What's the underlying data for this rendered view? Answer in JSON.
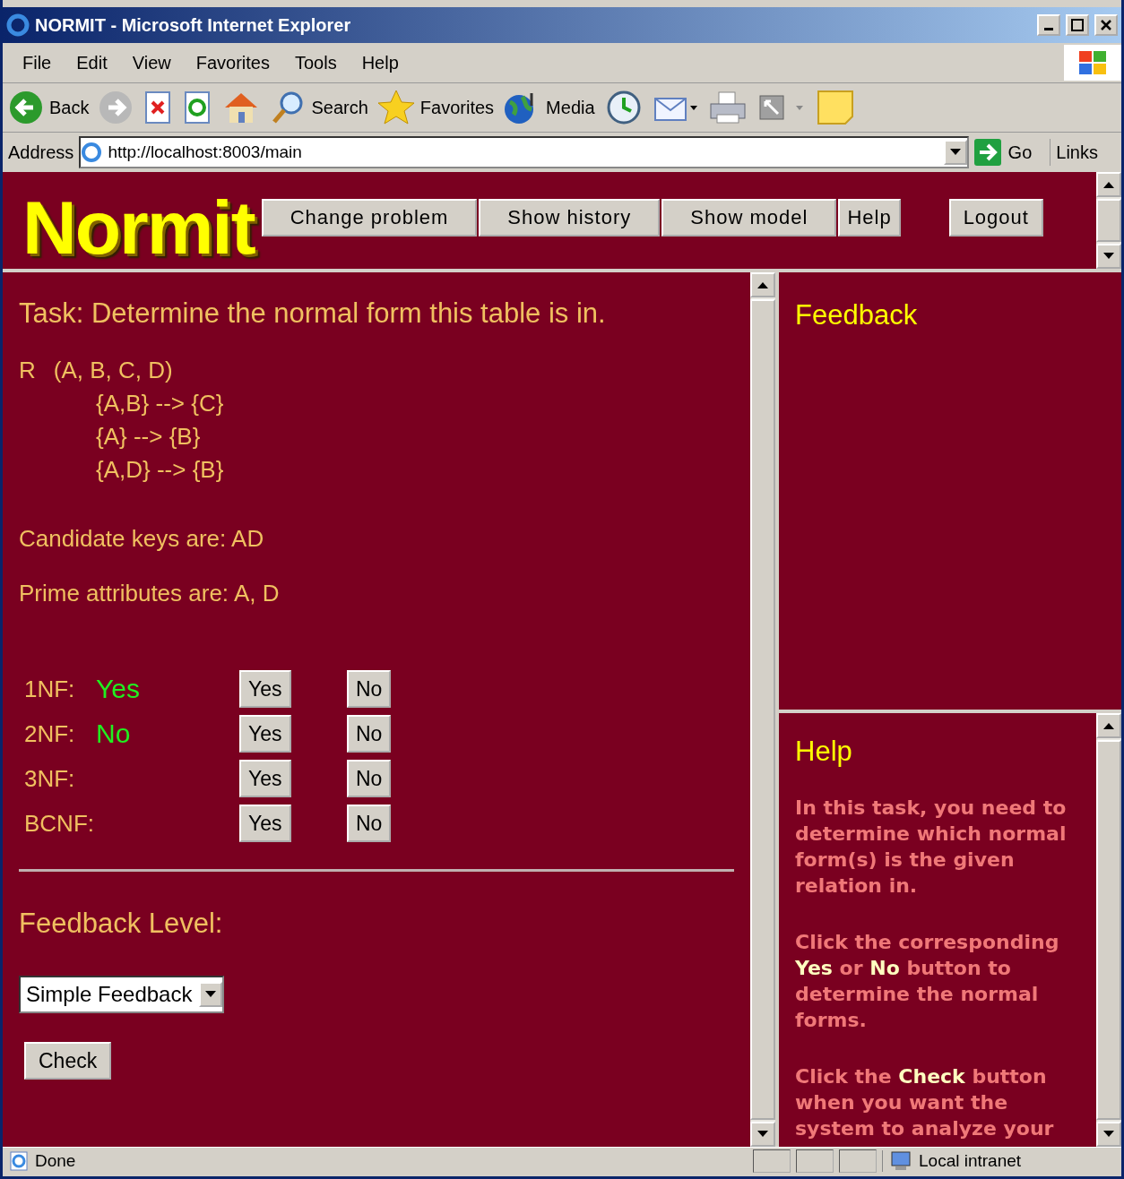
{
  "window": {
    "title": "NORMIT - Microsoft Internet Explorer"
  },
  "menu": [
    "File",
    "Edit",
    "View",
    "Favorites",
    "Tools",
    "Help"
  ],
  "toolbar": [
    {
      "kind": "back",
      "label": "Back"
    },
    {
      "kind": "forward"
    },
    {
      "kind": "stop"
    },
    {
      "kind": "refresh"
    },
    {
      "kind": "home"
    },
    {
      "kind": "search",
      "label": "Search"
    },
    {
      "kind": "favorites",
      "label": "Favorites"
    },
    {
      "kind": "media",
      "label": "Media"
    },
    {
      "kind": "history"
    },
    {
      "kind": "mail"
    },
    {
      "kind": "print"
    },
    {
      "kind": "edit"
    },
    {
      "kind": "note"
    }
  ],
  "address": {
    "label": "Address",
    "url": "http://localhost:8003/main",
    "go": "Go",
    "links": "Links"
  },
  "app": {
    "logo": "Normit",
    "nav": [
      "Change problem",
      "Show history",
      "Show model",
      "Help",
      "Logout"
    ]
  },
  "task": {
    "title": "Task: Determine the normal form this table is in.",
    "relation": "R",
    "attributes": "(A, B, C, D)",
    "dependencies": [
      "{A,B} --> {C}",
      "{A} --> {B}",
      "{A,D} --> {B}"
    ],
    "candidate_keys": "Candidate keys are: AD",
    "prime_attributes": "Prime attributes are: A, D"
  },
  "forms": [
    {
      "label": "1NF:",
      "answer": "Yes",
      "yes": "Yes",
      "no": "No"
    },
    {
      "label": "2NF:",
      "answer": "No",
      "yes": "Yes",
      "no": "No"
    },
    {
      "label": "3NF:",
      "yes": "Yes",
      "no": "No"
    },
    {
      "label": "BCNF:",
      "yes": "Yes",
      "no": "No"
    }
  ],
  "feedback_level": {
    "label": "Feedback Level:",
    "value": "Simple Feedback"
  },
  "check": "Check",
  "feedback": {
    "title": "Feedback"
  },
  "help": {
    "title": "Help",
    "paragraphs": [
      "In this task, you need to determine which normal form(s) is the given relation in.",
      "Click the corresponding **Yes** or **No** button to determine the normal forms.",
      "Click the **Check** button when you want the system to analyze your"
    ]
  },
  "status_bar": {
    "text": "Done",
    "zone": "Local intranet"
  }
}
